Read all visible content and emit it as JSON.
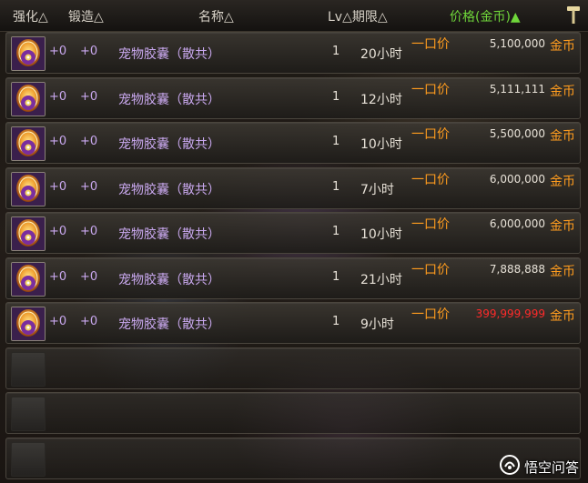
{
  "header": {
    "strength": "强化△",
    "forge": "锻造△",
    "name": "名称△",
    "lv_time": "Lv△期限△",
    "price": "价格(金币)▲",
    "tool_icon": "hammer-icon"
  },
  "colors": {
    "price_header": "#6fd63a",
    "item_name": "#c9a8ef",
    "price_type": "#ff9c1e",
    "price_normal": "#e8e2d8",
    "price_high": "#ff2a2a"
  },
  "listings": [
    {
      "icon": "pet-capsule-icon",
      "strength": "+0",
      "forge": "+0",
      "name": "宠物胶囊（散共）",
      "lv": "1",
      "time": "20小时",
      "price_type": "一口价",
      "price": "5,100,000",
      "currency": "金币"
    },
    {
      "icon": "pet-capsule-icon",
      "strength": "+0",
      "forge": "+0",
      "name": "宠物胶囊（散共）",
      "lv": "1",
      "time": "12小时",
      "price_type": "一口价",
      "price": "5,111,111",
      "currency": "金币"
    },
    {
      "icon": "pet-capsule-icon",
      "strength": "+0",
      "forge": "+0",
      "name": "宠物胶囊（散共）",
      "lv": "1",
      "time": "10小时",
      "price_type": "一口价",
      "price": "5,500,000",
      "currency": "金币"
    },
    {
      "icon": "pet-capsule-icon",
      "strength": "+0",
      "forge": "+0",
      "name": "宠物胶囊（散共）",
      "lv": "1",
      "time": "7小时",
      "price_type": "一口价",
      "price": "6,000,000",
      "currency": "金币"
    },
    {
      "icon": "pet-capsule-icon",
      "strength": "+0",
      "forge": "+0",
      "name": "宠物胶囊（散共）",
      "lv": "1",
      "time": "10小时",
      "price_type": "一口价",
      "price": "6,000,000",
      "currency": "金币"
    },
    {
      "icon": "pet-capsule-icon",
      "strength": "+0",
      "forge": "+0",
      "name": "宠物胶囊（散共）",
      "lv": "1",
      "time": "21小时",
      "price_type": "一口价",
      "price": "7,888,888",
      "currency": "金币"
    },
    {
      "icon": "pet-capsule-icon",
      "strength": "+0",
      "forge": "+0",
      "name": "宠物胶囊（散共）",
      "lv": "1",
      "time": "9小时",
      "price_type": "一口价",
      "price": "399,999,999",
      "currency": "金币",
      "highlight": true
    }
  ],
  "empty_slots": 3,
  "watermark": {
    "text": "悟空问答",
    "icon": "wukong-logo-icon"
  }
}
